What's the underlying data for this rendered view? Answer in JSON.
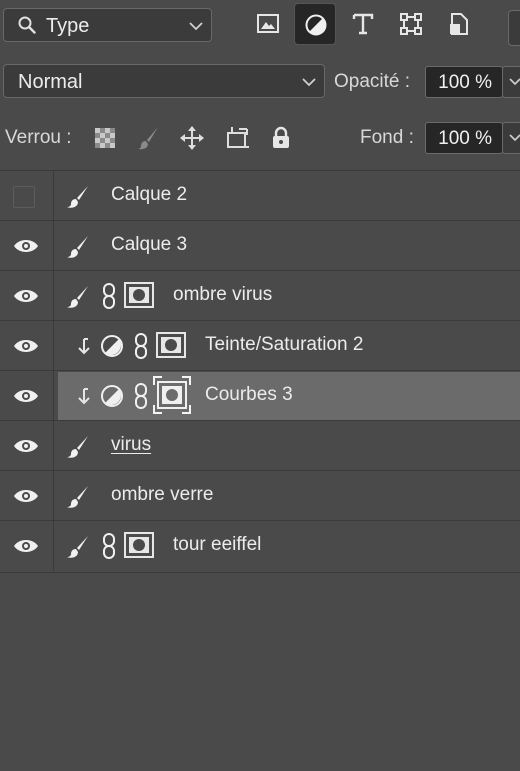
{
  "filter": {
    "kind_label": "Type",
    "filters": [
      {
        "name": "image-filter",
        "active": false
      },
      {
        "name": "adjustment-filter",
        "active": true
      },
      {
        "name": "text-filter",
        "active": false
      },
      {
        "name": "shape-filter",
        "active": false
      },
      {
        "name": "smart-object-filter",
        "active": false
      }
    ]
  },
  "blend": {
    "mode": "Normal",
    "opacity_label": "Opacité :",
    "opacity_value": "100 %"
  },
  "lock": {
    "label": "Verrou :",
    "fill_label": "Fond :",
    "fill_value": "100 %"
  },
  "layers": [
    {
      "name": "Calque 2",
      "visible": false
    },
    {
      "name": "Calque 3",
      "visible": true
    },
    {
      "name": "ombre virus",
      "visible": true
    },
    {
      "name": "Teinte/Saturation 2",
      "visible": true
    },
    {
      "name": "Courbes 3",
      "visible": true,
      "selected": true
    },
    {
      "name": "virus",
      "visible": true
    },
    {
      "name": "ombre verre",
      "visible": true
    },
    {
      "name": "tour eeiffel",
      "visible": true
    }
  ],
  "colors": {
    "panel_bg": "#4a4a4a",
    "field_bg": "#262626",
    "selected_row": "#6b6b6b",
    "text": "#ececec"
  }
}
